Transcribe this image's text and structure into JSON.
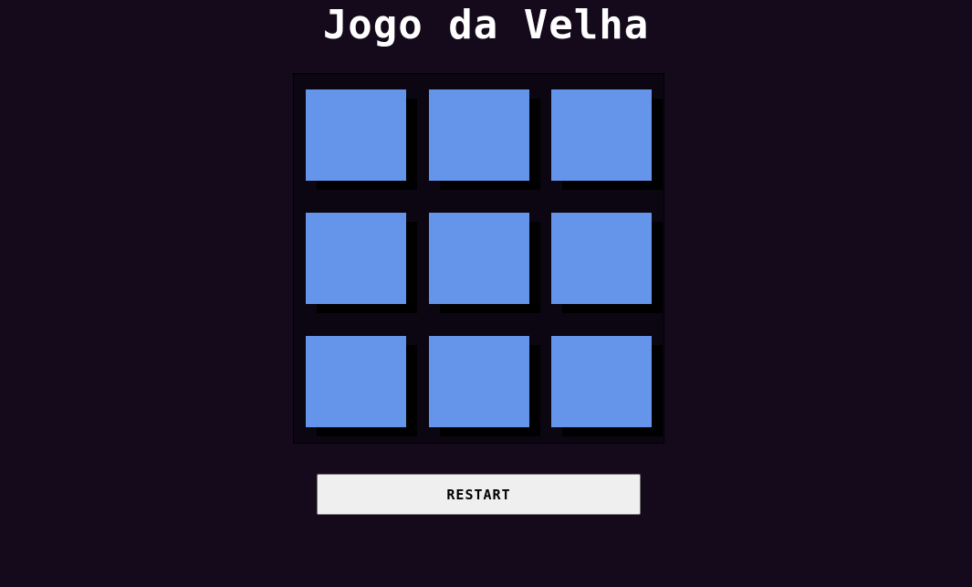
{
  "page": {
    "title": "Jogo da Velha"
  },
  "board": {
    "cells": [
      "",
      "",
      "",
      "",
      "",
      "",
      "",
      "",
      ""
    ]
  },
  "controls": {
    "restart_label": "RESTART"
  },
  "colors": {
    "background": "#150a1c",
    "board": "#0c0612",
    "cell": "#6495ea",
    "shadow": "#000000",
    "button": "#efefef"
  }
}
